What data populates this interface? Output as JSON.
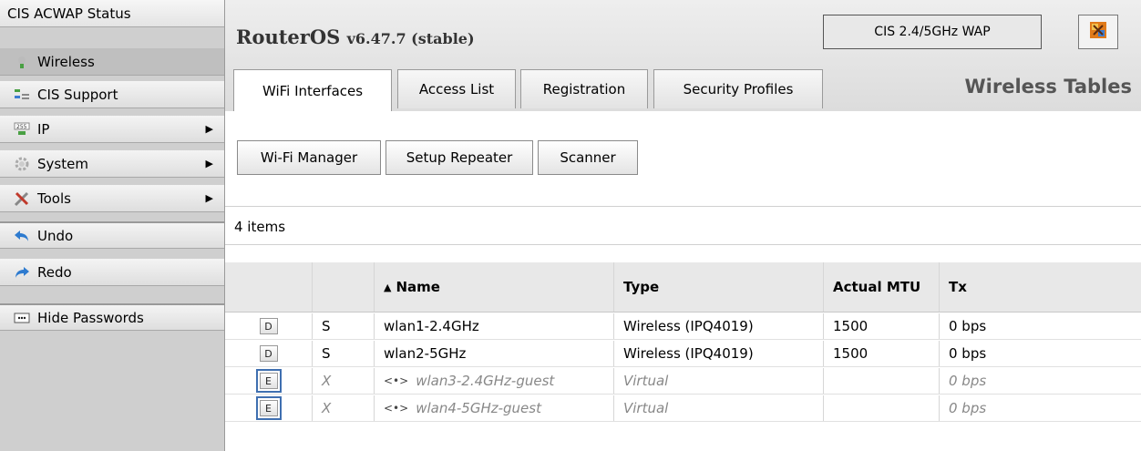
{
  "sidebar": {
    "header": "CIS ACWAP Status",
    "items": [
      {
        "label": "Wireless",
        "icon": "wireless-icon"
      },
      {
        "label": "CIS Support",
        "icon": "support-icon"
      },
      {
        "label": "IP",
        "icon": "ip-icon",
        "arrow": "▶"
      },
      {
        "label": "System",
        "icon": "gear-icon",
        "arrow": "▶"
      },
      {
        "label": "Tools",
        "icon": "tools-icon",
        "arrow": "▶"
      },
      {
        "label": "Undo",
        "icon": "undo-icon"
      },
      {
        "label": "Redo",
        "icon": "redo-icon"
      },
      {
        "label": "Hide Passwords",
        "icon": "password-dots-icon"
      }
    ]
  },
  "header": {
    "brand": "RouterOS",
    "version": "v6.47.7 (stable)",
    "device_name": "CIS 2.4/5GHz WAP",
    "section_title": "Wireless Tables"
  },
  "tabs": [
    {
      "label": "WiFi Interfaces"
    },
    {
      "label": "Access List"
    },
    {
      "label": "Registration"
    },
    {
      "label": "Security Profiles"
    }
  ],
  "toolbar": {
    "buttons": [
      {
        "label": "Wi-Fi Manager"
      },
      {
        "label": "Setup Repeater"
      },
      {
        "label": "Scanner"
      }
    ]
  },
  "items_count": "4 items",
  "table": {
    "sort_indicator": "▲",
    "columns": [
      "",
      "",
      "Name",
      "Type",
      "Actual MTU",
      "Tx"
    ],
    "rows": [
      {
        "btn": "D",
        "flag": "S",
        "icon": "",
        "name": "wlan1-2.4GHz",
        "type": "Wireless (IPQ4019)",
        "mtu": "1500",
        "tx": "0 bps"
      },
      {
        "btn": "D",
        "flag": "S",
        "icon": "",
        "name": "wlan2-5GHz",
        "type": "Wireless (IPQ4019)",
        "mtu": "1500",
        "tx": "0 bps"
      },
      {
        "btn": "E",
        "flag": "X",
        "icon": "<•>",
        "name": "wlan3-2.4GHz-guest",
        "type": "Virtual",
        "mtu": "",
        "tx": "0 bps"
      },
      {
        "btn": "E",
        "flag": "X",
        "icon": "<•>",
        "name": "wlan4-5GHz-guest",
        "type": "Virtual",
        "mtu": "",
        "tx": "0 bps"
      }
    ]
  },
  "colors": {
    "highlight_outline": "#3f6fb0",
    "sidebar_bg": "#cfcfcf"
  }
}
